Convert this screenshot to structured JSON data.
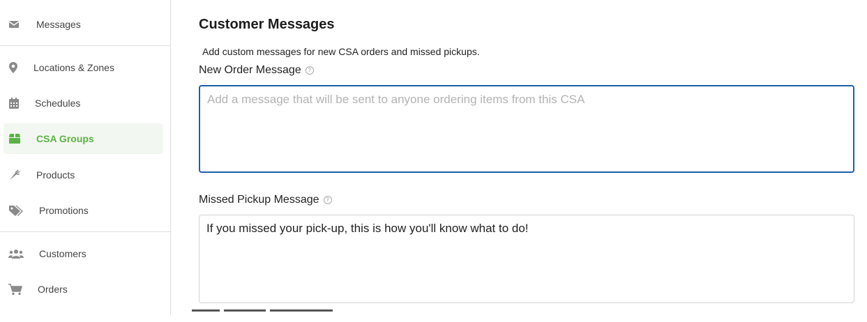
{
  "sidebar": {
    "items": [
      {
        "label": "Messages",
        "icon": "envelope-icon"
      },
      {
        "label": "Locations & Zones",
        "icon": "map-pin-icon"
      },
      {
        "label": "Schedules",
        "icon": "calendar-icon"
      },
      {
        "label": "CSA Groups",
        "icon": "box-icon",
        "active": true
      },
      {
        "label": "Products",
        "icon": "carrot-icon"
      },
      {
        "label": "Promotions",
        "icon": "tags-icon"
      },
      {
        "label": "Customers",
        "icon": "users-icon"
      },
      {
        "label": "Orders",
        "icon": "cart-icon"
      }
    ]
  },
  "main": {
    "title": "Customer Messages",
    "description": "Add custom messages for new CSA orders and missed pickups.",
    "new_order": {
      "label": "New Order Message",
      "placeholder": "Add a message that will be sent to anyone ordering items from this CSA",
      "value": ""
    },
    "missed_pickup": {
      "label": "Missed Pickup Message",
      "value": "If you missed your pick-up, this is how you'll know what to do!"
    },
    "help_glyph": "?"
  },
  "colors": {
    "accent": "#5bb345",
    "focus_border": "#1d5fa8",
    "icon_gray": "#8a8a8a"
  }
}
